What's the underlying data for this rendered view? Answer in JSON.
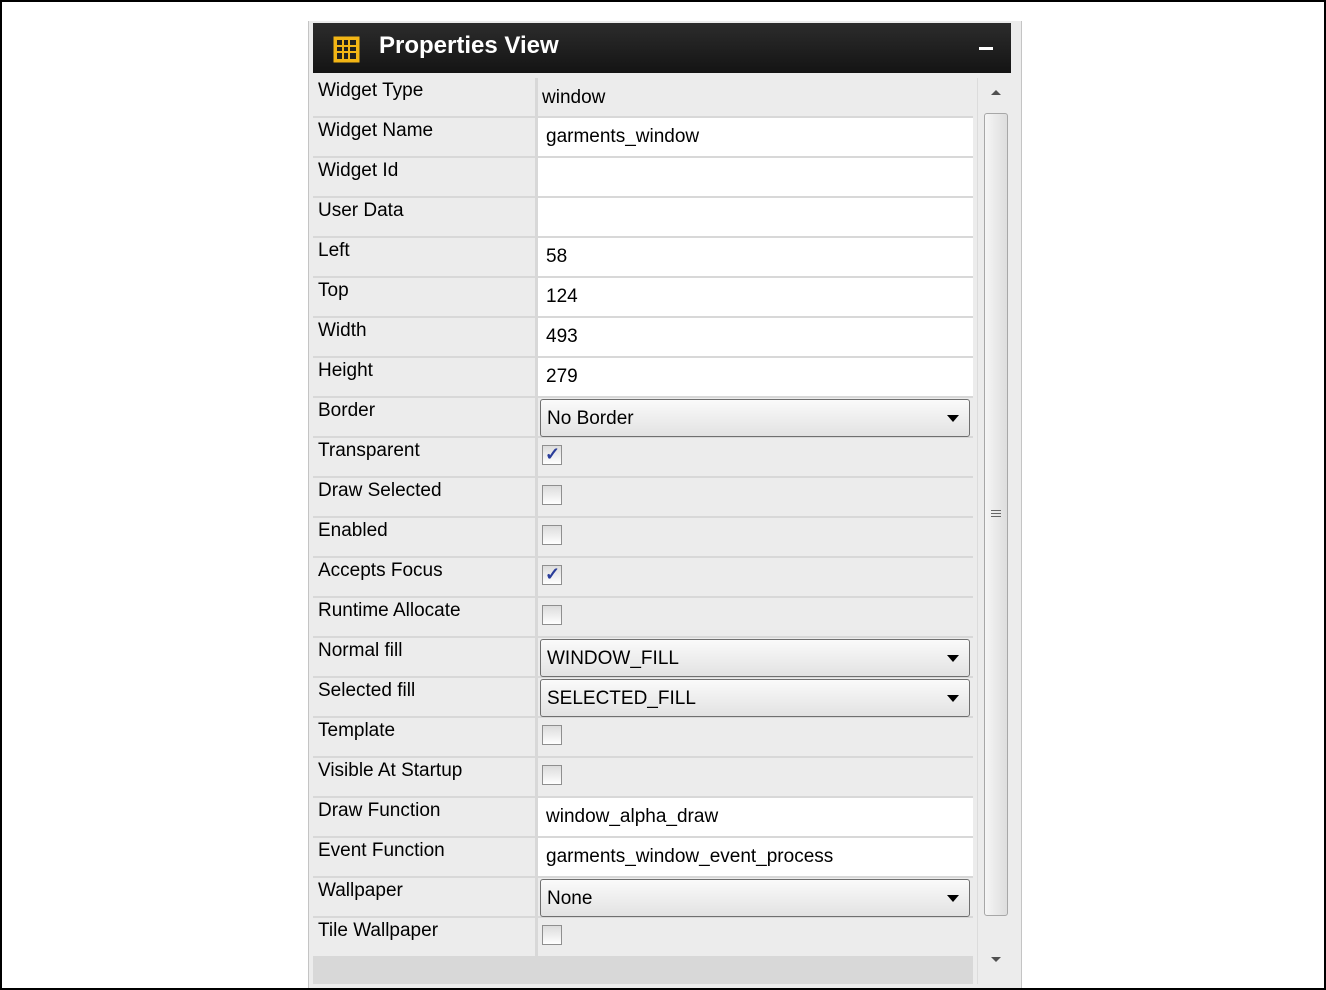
{
  "panel": {
    "title": "Properties View",
    "title_icon": "grid-table-icon",
    "minimize_icon": "minimize-icon"
  },
  "properties": [
    {
      "label": "Widget Type",
      "type": "readonly",
      "value": "window"
    },
    {
      "label": "Widget Name",
      "type": "text",
      "value": "garments_window"
    },
    {
      "label": "Widget Id",
      "type": "text",
      "value": ""
    },
    {
      "label": "User Data",
      "type": "text",
      "value": ""
    },
    {
      "label": "Left",
      "type": "text",
      "value": "58"
    },
    {
      "label": "Top",
      "type": "text",
      "value": "124"
    },
    {
      "label": "Width",
      "type": "text",
      "value": "493"
    },
    {
      "label": "Height",
      "type": "text",
      "value": "279"
    },
    {
      "label": "Border",
      "type": "dropdown",
      "value": "No Border"
    },
    {
      "label": "Transparent",
      "type": "checkbox",
      "checked": true
    },
    {
      "label": "Draw Selected",
      "type": "checkbox",
      "checked": false
    },
    {
      "label": "Enabled",
      "type": "checkbox",
      "checked": false
    },
    {
      "label": "Accepts Focus",
      "type": "checkbox",
      "checked": true
    },
    {
      "label": "Runtime Allocate",
      "type": "checkbox",
      "checked": false
    },
    {
      "label": "Normal fill",
      "type": "dropdown",
      "value": "WINDOW_FILL"
    },
    {
      "label": "Selected fill",
      "type": "dropdown",
      "value": "SELECTED_FILL"
    },
    {
      "label": "Template",
      "type": "checkbox",
      "checked": false
    },
    {
      "label": "Visible At Startup",
      "type": "checkbox",
      "checked": false
    },
    {
      "label": "Draw Function",
      "type": "text",
      "value": "window_alpha_draw"
    },
    {
      "label": "Event Function",
      "type": "text",
      "value": "garments_window_event_process"
    },
    {
      "label": "Wallpaper",
      "type": "dropdown",
      "value": "None"
    },
    {
      "label": "Tile Wallpaper",
      "type": "checkbox",
      "checked": false
    }
  ],
  "checkmark_glyph": "✓"
}
